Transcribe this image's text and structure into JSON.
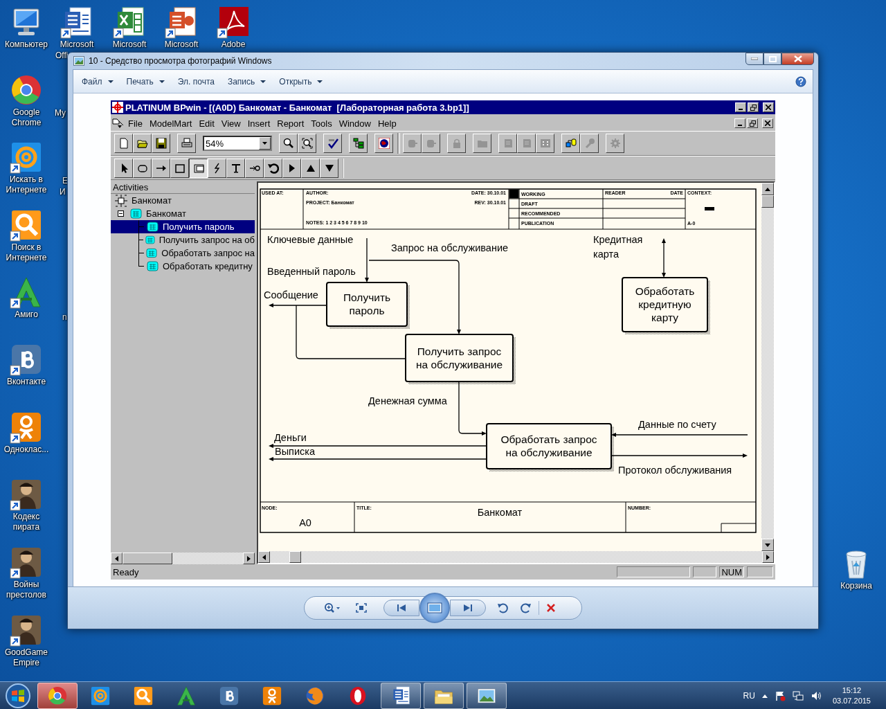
{
  "desktop": {
    "icons": [
      {
        "kind": "computer",
        "label": "Компьютер",
        "shortcut": false
      },
      {
        "kind": "word",
        "label": "Microsoft",
        "shortcut": true
      },
      {
        "kind": "excel",
        "label": "Microsoft",
        "shortcut": true
      },
      {
        "kind": "powerpoint",
        "label": "Microsoft",
        "shortcut": true
      },
      {
        "kind": "acrobat",
        "label": "Adobe",
        "shortcut": true
      },
      {
        "kind": "chrome",
        "label": "Google Chrome",
        "shortcut": false
      },
      {
        "kind": "at",
        "label": "Искать в Интернете",
        "shortcut": true
      },
      {
        "kind": "magnifier",
        "label": "Поиск в Интернете",
        "shortcut": true
      },
      {
        "kind": "amigo",
        "label": "Амиго",
        "shortcut": true
      },
      {
        "kind": "vk",
        "label": "Вконтакте",
        "shortcut": true
      },
      {
        "kind": "ok",
        "label": "Одноклас...",
        "shortcut": true
      },
      {
        "kind": "figure",
        "label": "Кодекс пирата",
        "shortcut": true
      },
      {
        "kind": "figure",
        "label": "Войны престолов",
        "shortcut": true
      },
      {
        "kind": "figure",
        "label": "GoodGame Empire",
        "shortcut": true
      },
      {
        "kind": "recycle",
        "label": "Корзина",
        "shortcut": false
      }
    ],
    "covered_labels": [
      "Offi",
      "My",
      "E",
      "И",
      "n"
    ]
  },
  "viewer": {
    "title": "10 - Средство просмотра фотографий Windows",
    "menu": [
      {
        "label": "Файл",
        "dropdown": true
      },
      {
        "label": "Печать",
        "dropdown": true
      },
      {
        "label": "Эл. почта",
        "dropdown": false
      },
      {
        "label": "Запись",
        "dropdown": true
      },
      {
        "label": "Открыть",
        "dropdown": true
      }
    ]
  },
  "bpwin": {
    "title": "PLATINUM BPwin - [(A0D) Банкомат - Банкомат  [Лабораторная работа 3.bp1]]",
    "menu": [
      "File",
      "ModelMart",
      "Edit",
      "View",
      "Insert",
      "Report",
      "Tools",
      "Window",
      "Help"
    ],
    "toolbar": [
      [
        {
          "kind": "new",
          "disabled": false
        },
        {
          "kind": "open",
          "disabled": false
        },
        {
          "kind": "save",
          "disabled": false
        }
      ],
      [
        {
          "kind": "print",
          "disabled": false
        }
      ],
      [
        {
          "kind": "zoom",
          "disabled": false
        },
        {
          "kind": "fit",
          "disabled": false
        }
      ],
      [
        {
          "kind": "spell",
          "disabled": false
        }
      ],
      [
        {
          "kind": "tree",
          "disabled": false
        }
      ],
      [
        {
          "kind": "globe",
          "disabled": false
        }
      ],
      [
        {
          "kind": "cube",
          "disabled": true
        },
        {
          "kind": "cube",
          "disabled": true
        }
      ],
      [
        {
          "kind": "lock",
          "disabled": true
        }
      ],
      [
        {
          "kind": "folder",
          "disabled": true
        }
      ],
      [
        {
          "kind": "page",
          "disabled": true
        },
        {
          "kind": "page",
          "disabled": true
        },
        {
          "kind": "grid",
          "disabled": true
        }
      ],
      [
        {
          "kind": "db",
          "disabled": false
        },
        {
          "kind": "wrench",
          "disabled": true
        }
      ],
      [
        {
          "kind": "gear",
          "disabled": true
        }
      ]
    ],
    "zoom": "54%",
    "tools": [
      {
        "kind": "pointer",
        "selected": false
      },
      {
        "kind": "oval",
        "selected": false
      },
      {
        "kind": "arrow",
        "selected": false
      },
      {
        "kind": "square",
        "selected": false
      },
      {
        "kind": "offpage",
        "selected": true
      },
      {
        "kind": "squiggle",
        "selected": false
      },
      {
        "kind": "text",
        "selected": false
      },
      {
        "kind": "tunnel",
        "selected": false
      },
      {
        "kind": "rotate",
        "selected": false
      },
      {
        "kind": "right",
        "selected": false
      },
      {
        "kind": "up",
        "selected": false
      },
      {
        "kind": "down",
        "selected": false
      }
    ],
    "tree": {
      "header": "Activities",
      "items": [
        {
          "label": "Банкомат",
          "kind": "context",
          "selected": false
        },
        {
          "label": "Банкомат",
          "kind": "diagram",
          "selected": false,
          "expanded": true,
          "children": [
            {
              "label": "Получить пароль",
              "kind": "activity",
              "selected": true
            },
            {
              "label": "Получить запрос на об",
              "kind": "activity",
              "selected": false
            },
            {
              "label": "Обработать запрос на",
              "kind": "activity",
              "selected": false
            },
            {
              "label": "Обработать кредитну",
              "kind": "activity",
              "selected": false
            }
          ]
        }
      ]
    },
    "status": {
      "text": "Ready",
      "indicator": "NUM"
    }
  },
  "diagram": {
    "header": {
      "used_at": "USED AT:",
      "author": "AUTHOR:",
      "project": "PROJECT: Банкомат",
      "notes": "NOTES: 1 2 3 4 5 6 7 8 9 10",
      "date": "DATE: 30.10.01",
      "rev": "REV: 30.10.01",
      "statuses": [
        {
          "label": "WORKING",
          "checked": true
        },
        {
          "label": "DRAFT",
          "checked": false
        },
        {
          "label": "RECOMMENDED",
          "checked": false
        },
        {
          "label": "PUBLICATION",
          "checked": false
        }
      ],
      "reader": "READER",
      "reader_date": "DATE",
      "context": "CONTEXT:",
      "context_node": "A-0"
    },
    "boxes": [
      {
        "lines": [
          "Получить",
          "пароль"
        ]
      },
      {
        "lines": [
          "Получить запрос",
          "на обслуживание"
        ]
      },
      {
        "lines": [
          "Обработать запрос",
          "на обслуживание"
        ]
      },
      {
        "lines": [
          "Обработать",
          "кредитную",
          "карту"
        ]
      }
    ],
    "arrow_labels": [
      {
        "lines": [
          "Ключевые данные"
        ]
      },
      {
        "lines": [
          "Запрос на обслуживание"
        ]
      },
      {
        "lines": [
          "Введенный пароль"
        ]
      },
      {
        "lines": [
          "Сообщение"
        ]
      },
      {
        "lines": [
          "Кредитная",
          "карта"
        ]
      },
      {
        "lines": [
          "Денежная сумма"
        ]
      },
      {
        "lines": [
          "Данные по счету"
        ]
      },
      {
        "lines": [
          "Деньги"
        ]
      },
      {
        "lines": [
          "Выписка"
        ]
      },
      {
        "lines": [
          "Протокол обслуживания"
        ]
      }
    ],
    "footer": {
      "node_label": "NODE:",
      "node": "A0",
      "title_label": "TITLE:",
      "title": "Банкомат",
      "number_label": "NUMBER:"
    }
  },
  "taskbar": {
    "items": [
      {
        "kind": "chrome",
        "running": false,
        "highlighted": true
      },
      {
        "kind": "at",
        "running": false,
        "highlighted": false
      },
      {
        "kind": "magnifier",
        "running": false,
        "highlighted": false
      },
      {
        "kind": "amigo",
        "running": false,
        "highlighted": false
      },
      {
        "kind": "vk",
        "running": false,
        "highlighted": false
      },
      {
        "kind": "ok",
        "running": false,
        "highlighted": false
      },
      {
        "kind": "firefox",
        "running": false,
        "highlighted": false
      },
      {
        "kind": "opera",
        "running": false,
        "highlighted": false
      },
      {
        "kind": "word",
        "running": true,
        "highlighted": false
      },
      {
        "kind": "folder",
        "running": true,
        "highlighted": false
      },
      {
        "kind": "photo",
        "running": true,
        "highlighted": false
      }
    ],
    "tray": {
      "language": "RU",
      "time": "15:12",
      "date": "03.07.2015"
    }
  }
}
